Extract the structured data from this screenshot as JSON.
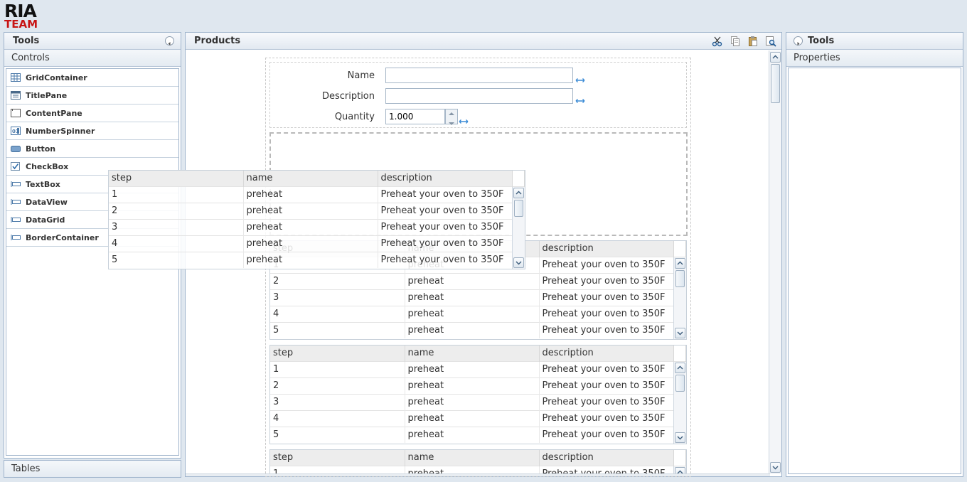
{
  "logo": {
    "line1": "RIA",
    "line2": "TEAM"
  },
  "left_panel": {
    "title": "Tools",
    "section": "Controls",
    "controls": [
      {
        "label": "GridContainer",
        "icon": "grid-icon"
      },
      {
        "label": "TitlePane",
        "icon": "titlepane-icon"
      },
      {
        "label": "ContentPane",
        "icon": "contentpane-icon"
      },
      {
        "label": "NumberSpinner",
        "icon": "numberspinner-icon"
      },
      {
        "label": "Button",
        "icon": "button-icon"
      },
      {
        "label": "CheckBox",
        "icon": "checkbox-icon"
      },
      {
        "label": "TextBox",
        "icon": "textbox-icon"
      },
      {
        "label": "DataView",
        "icon": "textbox-icon"
      },
      {
        "label": "DataGrid",
        "icon": "textbox-icon"
      },
      {
        "label": "BorderContainer",
        "icon": "textbox-icon"
      }
    ],
    "bottom_section": "Tables"
  },
  "center_panel": {
    "title": "Products",
    "toolbar": [
      "cut-icon",
      "copy-icon",
      "paste-icon",
      "preview-icon"
    ],
    "form": {
      "name_label": "Name",
      "name_value": "",
      "description_label": "Description",
      "description_value": "",
      "quantity_label": "Quantity",
      "quantity_value": "1.000"
    }
  },
  "right_panel": {
    "title": "Tools",
    "section": "Properties"
  },
  "grid": {
    "columns": [
      "step",
      "name",
      "description"
    ],
    "rows": [
      [
        "1",
        "preheat",
        "Preheat your oven to 350F"
      ],
      [
        "2",
        "preheat",
        "Preheat your oven to 350F"
      ],
      [
        "3",
        "preheat",
        "Preheat your oven to 350F"
      ],
      [
        "4",
        "preheat",
        "Preheat your oven to 350F"
      ],
      [
        "5",
        "preheat",
        "Preheat your oven to 350F"
      ]
    ]
  },
  "colors": {
    "accent": "#c81414",
    "border": "#9fb4cc",
    "header": "#e2e9f1"
  }
}
